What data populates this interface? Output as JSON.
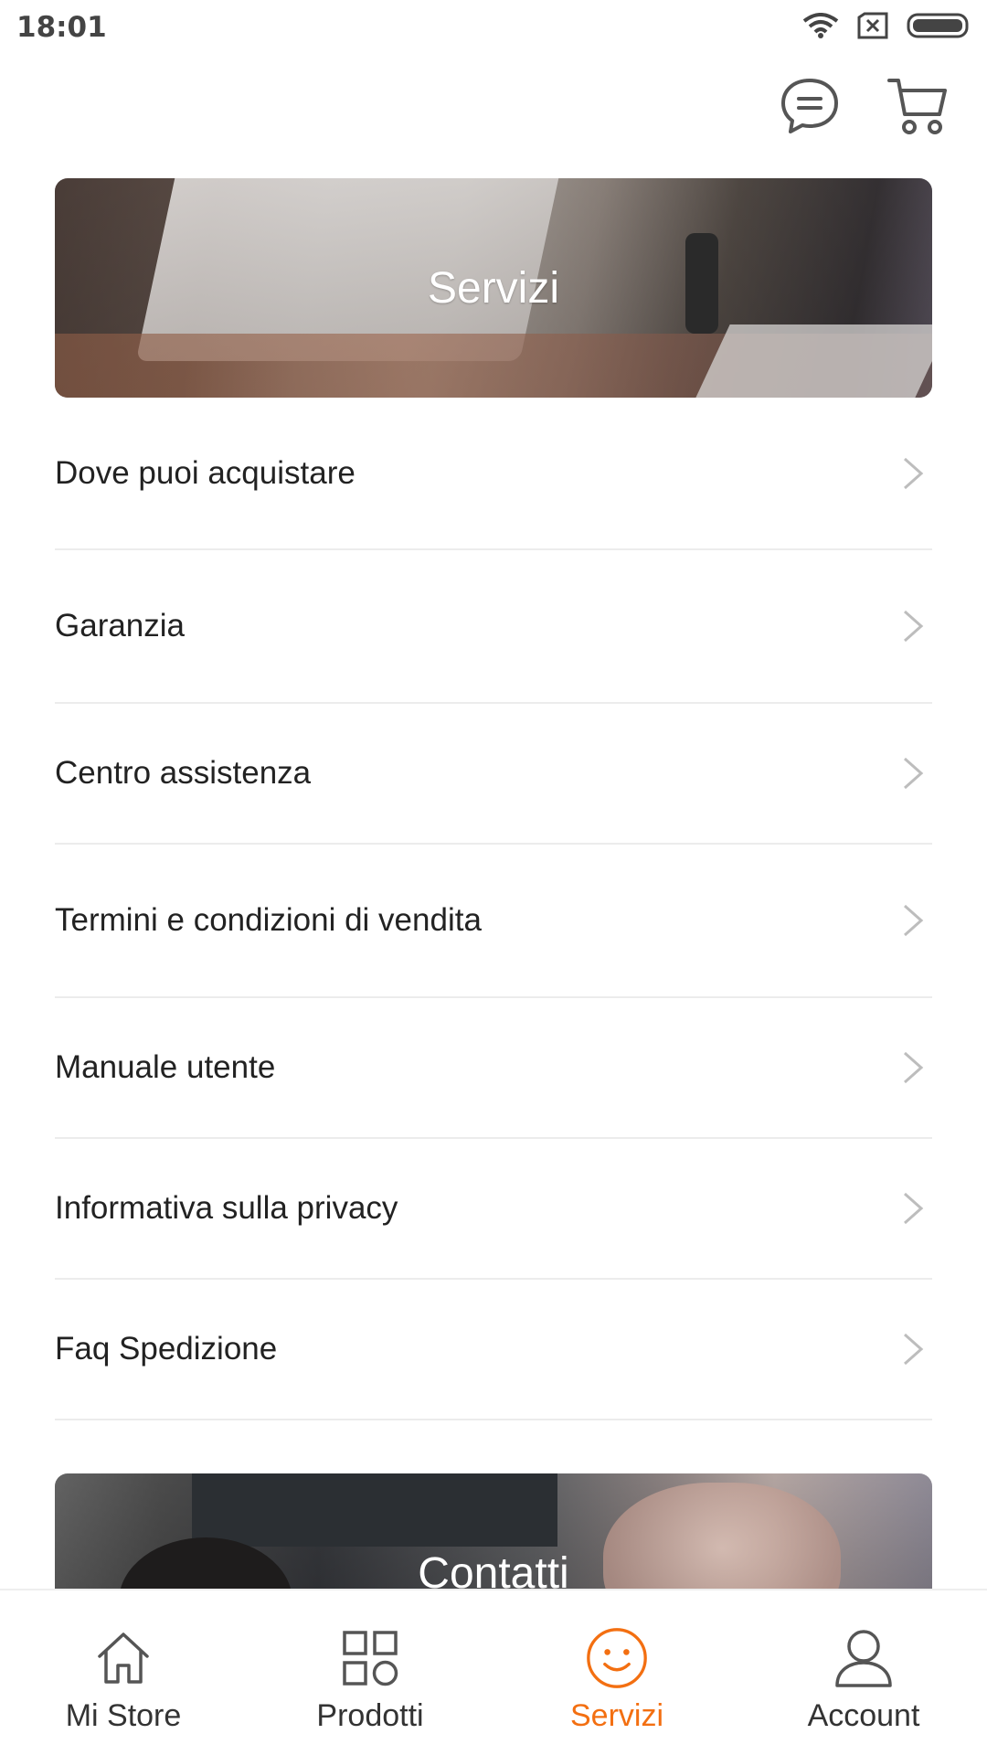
{
  "status_bar": {
    "time": "18:01",
    "icons": [
      "wifi-icon",
      "sim-off-icon",
      "battery-icon"
    ]
  },
  "header": {
    "actions": [
      {
        "icon": "chat-icon"
      },
      {
        "icon": "cart-icon"
      }
    ]
  },
  "banner": {
    "title": "Servizi"
  },
  "menu": {
    "items": [
      {
        "label": "Dove puoi acquistare"
      },
      {
        "label": "Garanzia"
      },
      {
        "label": "Centro assistenza"
      },
      {
        "label": "Termini e condizioni di vendita"
      },
      {
        "label": "Manuale utente"
      },
      {
        "label": "Informativa sulla privacy"
      },
      {
        "label": "Faq Spedizione"
      }
    ]
  },
  "contact_banner": {
    "title": "Contatti"
  },
  "bottom_nav": {
    "items": [
      {
        "label": "Mi Store",
        "icon": "home-icon",
        "active": false
      },
      {
        "label": "Prodotti",
        "icon": "grid-icon",
        "active": false
      },
      {
        "label": "Servizi",
        "icon": "smiley-icon",
        "active": true
      },
      {
        "label": "Account",
        "icon": "user-icon",
        "active": false
      }
    ]
  },
  "colors": {
    "accent": "#f36f11",
    "text": "#222222",
    "divider": "#ececec",
    "icon_gray": "#555555"
  }
}
